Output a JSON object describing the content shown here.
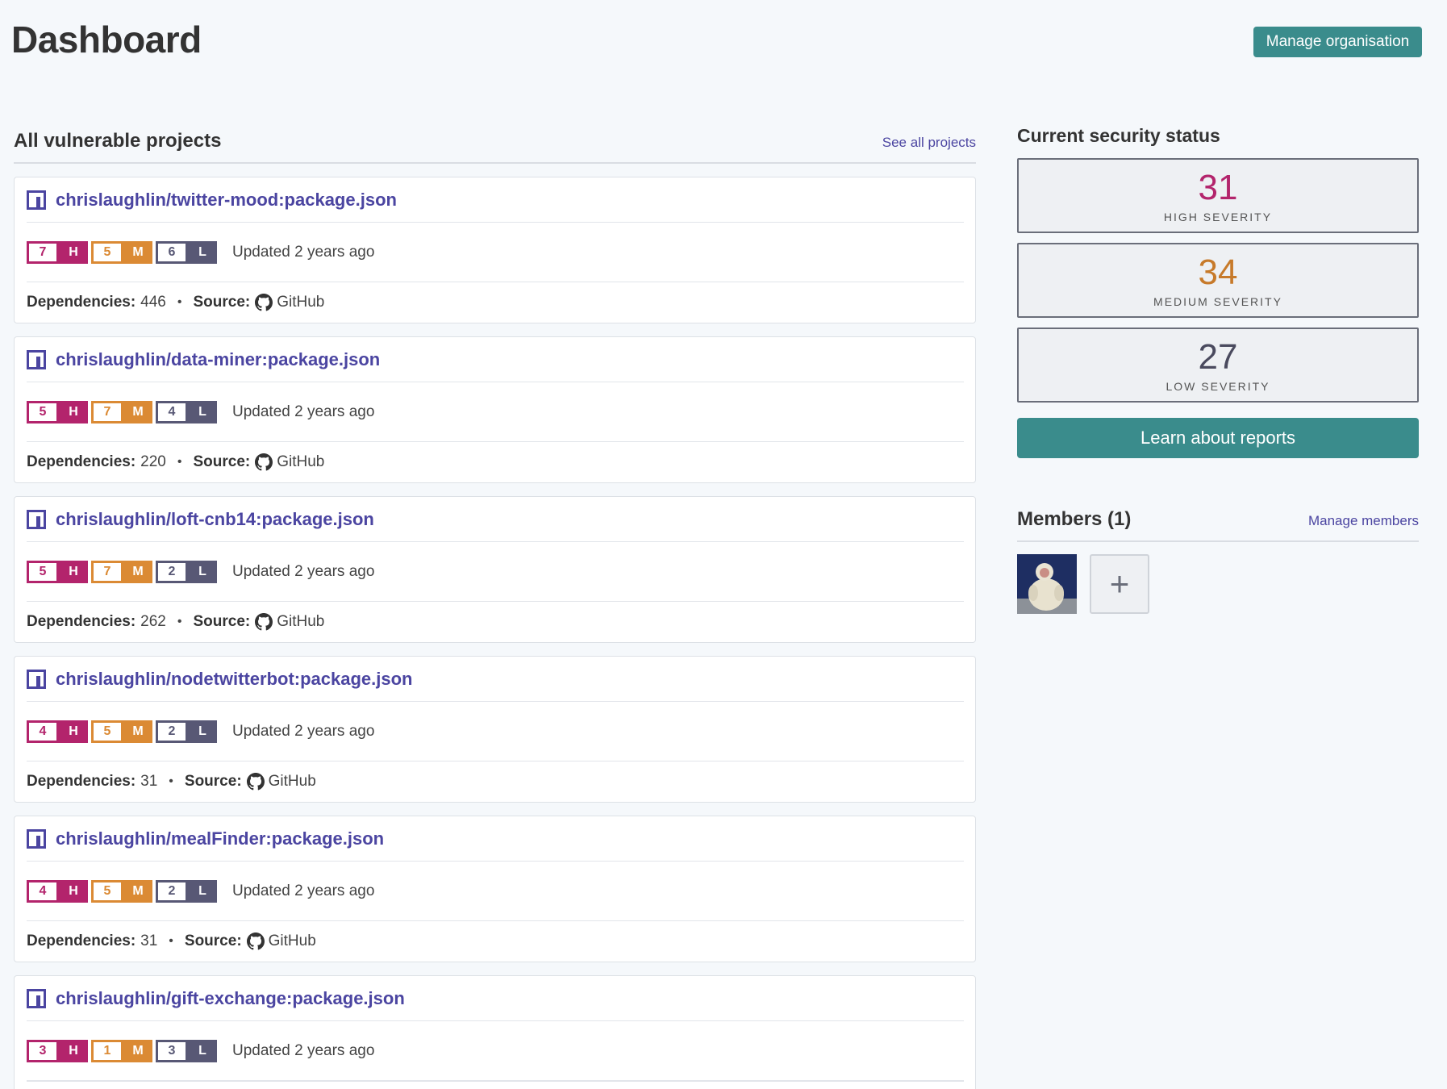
{
  "header": {
    "title": "Dashboard",
    "manage_org_label": "Manage organisation"
  },
  "projects_section": {
    "title": "All vulnerable projects",
    "see_all_label": "See all projects",
    "dependencies_label": "Dependencies:",
    "source_label": "Source:",
    "projects": [
      {
        "name": "chrislaughlin/twitter-mood:package.json",
        "high": "7",
        "medium": "5",
        "low": "6",
        "updated": "Updated 2 years ago",
        "dependencies": "446",
        "source": "GitHub"
      },
      {
        "name": "chrislaughlin/data-miner:package.json",
        "high": "5",
        "medium": "7",
        "low": "4",
        "updated": "Updated 2 years ago",
        "dependencies": "220",
        "source": "GitHub"
      },
      {
        "name": "chrislaughlin/loft-cnb14:package.json",
        "high": "5",
        "medium": "7",
        "low": "2",
        "updated": "Updated 2 years ago",
        "dependencies": "262",
        "source": "GitHub"
      },
      {
        "name": "chrislaughlin/nodetwitterbot:package.json",
        "high": "4",
        "medium": "5",
        "low": "2",
        "updated": "Updated 2 years ago",
        "dependencies": "31",
        "source": "GitHub"
      },
      {
        "name": "chrislaughlin/mealFinder:package.json",
        "high": "4",
        "medium": "5",
        "low": "2",
        "updated": "Updated 2 years ago",
        "dependencies": "31",
        "source": "GitHub"
      },
      {
        "name": "chrislaughlin/gift-exchange:package.json",
        "high": "3",
        "medium": "1",
        "low": "3",
        "updated": "Updated 2 years ago"
      }
    ],
    "level_letters": {
      "high": "H",
      "medium": "M",
      "low": "L"
    }
  },
  "security_status": {
    "title": "Current security status",
    "high": {
      "count": "31",
      "label": "HIGH SEVERITY"
    },
    "medium": {
      "count": "34",
      "label": "MEDIUM SEVERITY"
    },
    "low": {
      "count": "27",
      "label": "LOW SEVERITY"
    },
    "learn_label": "Learn about reports"
  },
  "members": {
    "title": "Members (1)",
    "manage_label": "Manage members",
    "add_symbol": "+"
  },
  "colors": {
    "accent": "#3a8c8c",
    "link": "#4b45a1",
    "high": "#b3246c",
    "medium": "#db8a34",
    "low": "#585875"
  },
  "icons": [
    "project-icon",
    "github-icon",
    "plus-icon"
  ]
}
